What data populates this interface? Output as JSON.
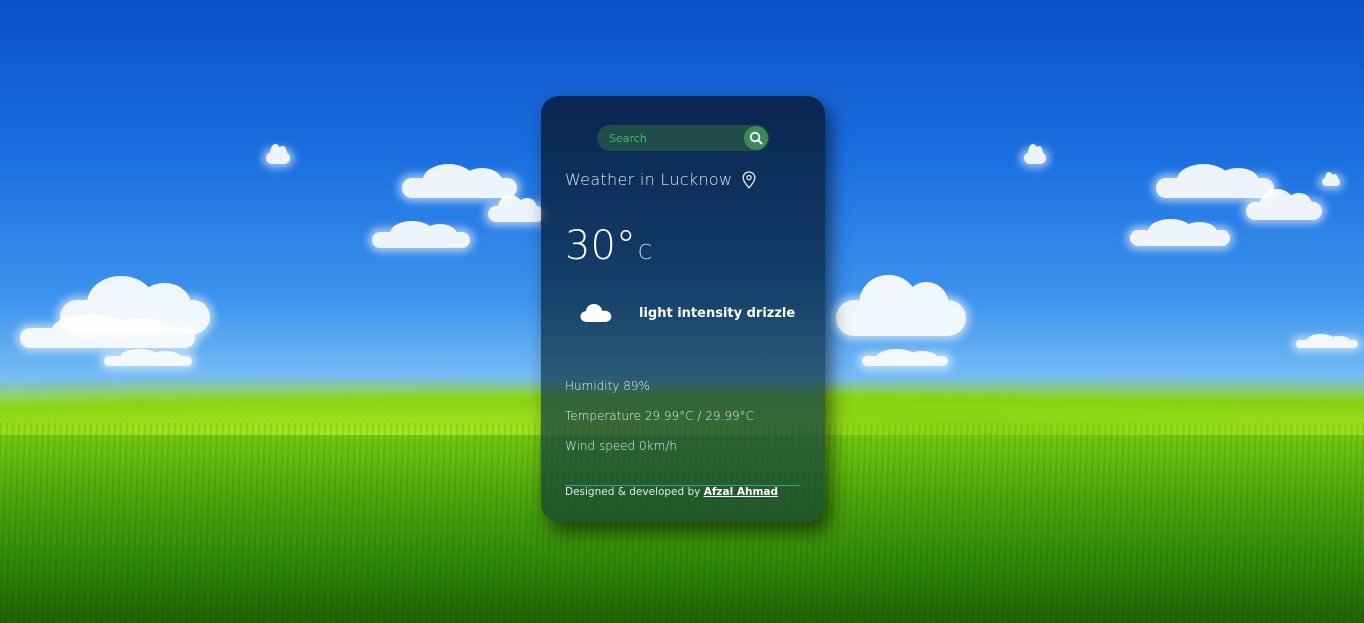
{
  "search": {
    "placeholder": "Search"
  },
  "weather": {
    "title": "Weather in Lucknow",
    "temperature": "30°",
    "unit": "C",
    "description": "light intensity drizzle",
    "humidity": "Humidity 89%",
    "temperature_range": "Temperature 29.99°C / 29.99°C",
    "wind": "Wind speed 0km/h"
  },
  "footer": {
    "credit_text": "Designed & developed by",
    "author": "Afzal Ahmad"
  },
  "icons": {
    "search": "search-icon",
    "location": "location-pin-icon",
    "weather": "cloud-icon"
  },
  "colors": {
    "card_bg": "#0a2a46",
    "search_bg": "#285a46",
    "search_button": "#3c8a5a",
    "placeholder": "#39b96a",
    "divider": "#2aa6a0"
  }
}
